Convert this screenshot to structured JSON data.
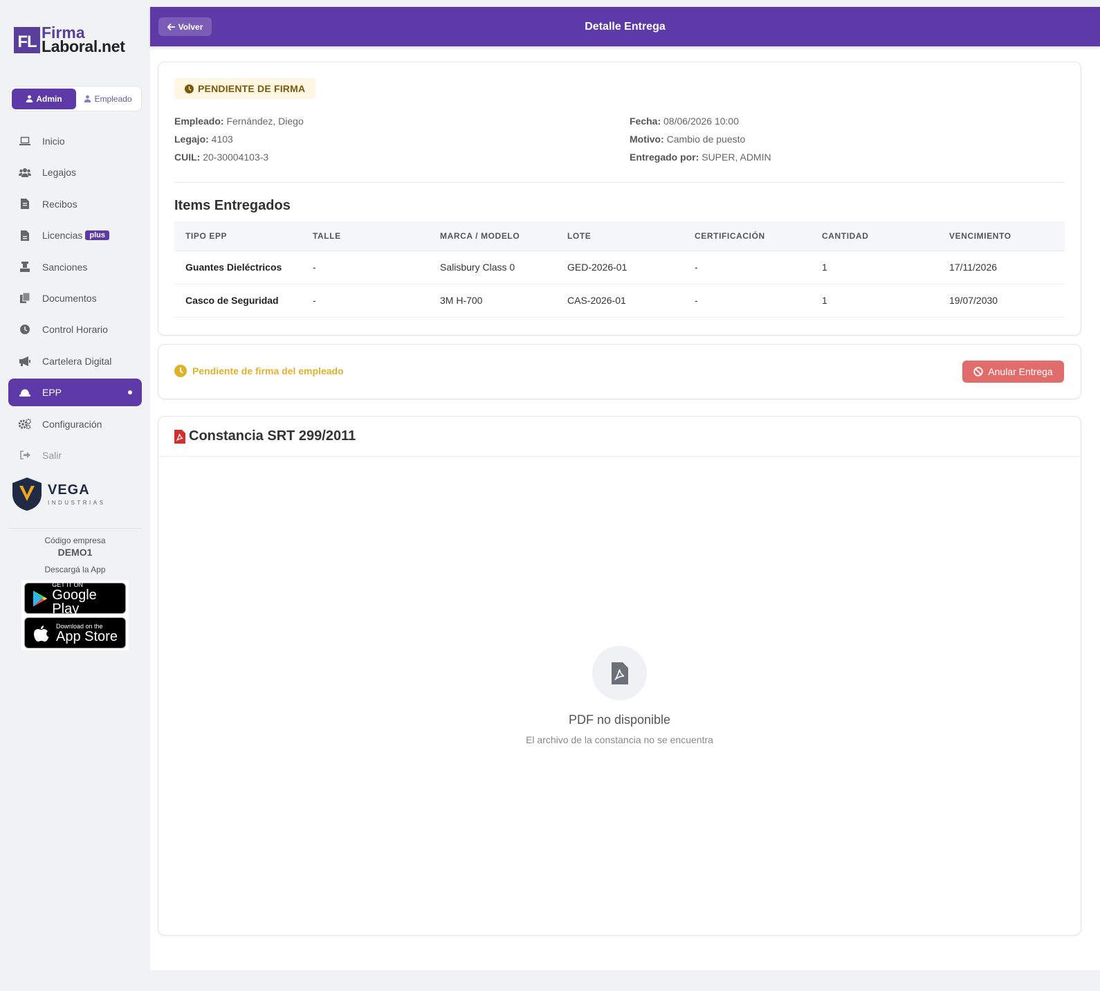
{
  "app": {
    "logo_line1": "Firma",
    "logo_line2": "Laboral.net",
    "logo_mark": "FL"
  },
  "roles": {
    "admin": "Admin",
    "employee": "Empleado"
  },
  "nav": [
    {
      "label": "Inicio",
      "icon": "laptop-icon"
    },
    {
      "label": "Legajos",
      "icon": "users-icon"
    },
    {
      "label": "Recibos",
      "icon": "receipt-icon"
    },
    {
      "label": "Licencias",
      "icon": "file-icon",
      "badge": "plus"
    },
    {
      "label": "Sanciones",
      "icon": "gavel-icon"
    },
    {
      "label": "Documentos",
      "icon": "copy-icon"
    },
    {
      "label": "Control Horario",
      "icon": "clock-icon"
    },
    {
      "label": "Cartelera Digital",
      "icon": "megaphone-icon"
    },
    {
      "label": "EPP",
      "icon": "hard-hat-icon",
      "active": true
    },
    {
      "label": "Configuración",
      "icon": "cogs-icon"
    },
    {
      "label": "Salir",
      "icon": "sign-out-icon"
    }
  ],
  "company_logo": {
    "name": "VEGA",
    "tagline": "INDUSTRIAS"
  },
  "company": {
    "code_label": "Código empresa",
    "code": "DEMO1",
    "download_label": "Descargá la App"
  },
  "stores": {
    "google_small": "GET IT ON",
    "google_big": "Google Play",
    "apple_small": "Download on the",
    "apple_big": "App Store"
  },
  "header": {
    "back_label": "Volver",
    "title": "Detalle Entrega"
  },
  "delivery": {
    "status": "PENDIENTE DE FIRMA",
    "fields_left": [
      {
        "label": "Empleado:",
        "value": "Fernández, Diego"
      },
      {
        "label": "Legajo:",
        "value": "4103"
      },
      {
        "label": "CUIL:",
        "value": "20-30004103-3"
      }
    ],
    "fields_right": [
      {
        "label": "Fecha:",
        "value": "08/06/2026 10:00"
      },
      {
        "label": "Motivo:",
        "value": "Cambio de puesto"
      },
      {
        "label": "Entregado por:",
        "value": "SUPER, ADMIN"
      }
    ],
    "items_title": "Items Entregados",
    "columns": [
      "TIPO EPP",
      "TALLE",
      "MARCA / MODELO",
      "LOTE",
      "CERTIFICACIÓN",
      "CANTIDAD",
      "VENCIMIENTO"
    ],
    "rows": [
      [
        "Guantes Dieléctricos",
        "-",
        "Salisbury Class 0",
        "GED-2026-01",
        "-",
        "1",
        "17/11/2026"
      ],
      [
        "Casco de Seguridad",
        "-",
        "3M H-700",
        "CAS-2026-01",
        "-",
        "1",
        "19/07/2030"
      ]
    ]
  },
  "signature": {
    "pending_message": "Pendiente de firma del empleado",
    "void_button": "Anular Entrega"
  },
  "constancia": {
    "title": "Constancia SRT 299/2011",
    "unavailable_title": "PDF no disponible",
    "unavailable_sub": "El archivo de la constancia no se encuentra"
  },
  "colors": {
    "brand": "#5e3aa8",
    "warning": "#e0b12a",
    "danger": "#e06c6c",
    "pdf_red": "#d32f2f"
  }
}
